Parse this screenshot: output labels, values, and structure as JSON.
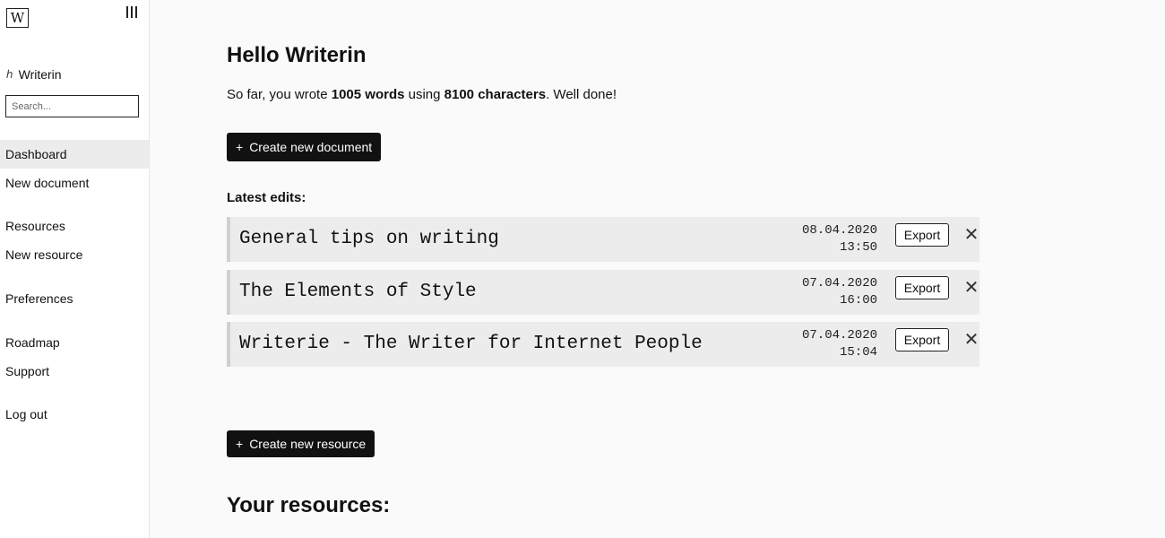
{
  "sidebar": {
    "logo": "W",
    "username": "Writerin",
    "user_icon": "user-icon",
    "search_placeholder": "Search...",
    "nav": [
      {
        "label": "Dashboard",
        "active": true
      },
      {
        "label": "New document"
      },
      {
        "label": "Resources"
      },
      {
        "label": "New resource"
      },
      {
        "label": "Preferences"
      },
      {
        "label": "Roadmap"
      },
      {
        "label": "Support"
      },
      {
        "label": "Log out"
      }
    ]
  },
  "main": {
    "greeting": "Hello Writerin",
    "summary": {
      "prefix": "So far, you wrote ",
      "words": "1005 words",
      "middle": " using ",
      "characters": "8100 characters",
      "suffix": ". Well done!"
    },
    "create_document_label": "Create new document",
    "latest_edits_label": "Latest edits:",
    "documents": [
      {
        "title": "General tips on writing",
        "date": "08.04.2020",
        "time": "13:50",
        "export_label": "Export",
        "delete_icon": "close-icon"
      },
      {
        "title": "The Elements of Style",
        "date": "07.04.2020",
        "time": "16:00",
        "export_label": "Export",
        "delete_icon": "close-icon"
      },
      {
        "title": "Writerie - The Writer for Internet People",
        "date": "07.04.2020",
        "time": "15:04",
        "export_label": "Export",
        "delete_icon": "close-icon"
      }
    ],
    "create_resource_label": "Create new resource",
    "resources_title": "Your resources:"
  },
  "colors": {
    "button_dark": "#111111",
    "row_background": "#ececec",
    "active_nav": "#ececec",
    "page_background": "#fafafa"
  }
}
